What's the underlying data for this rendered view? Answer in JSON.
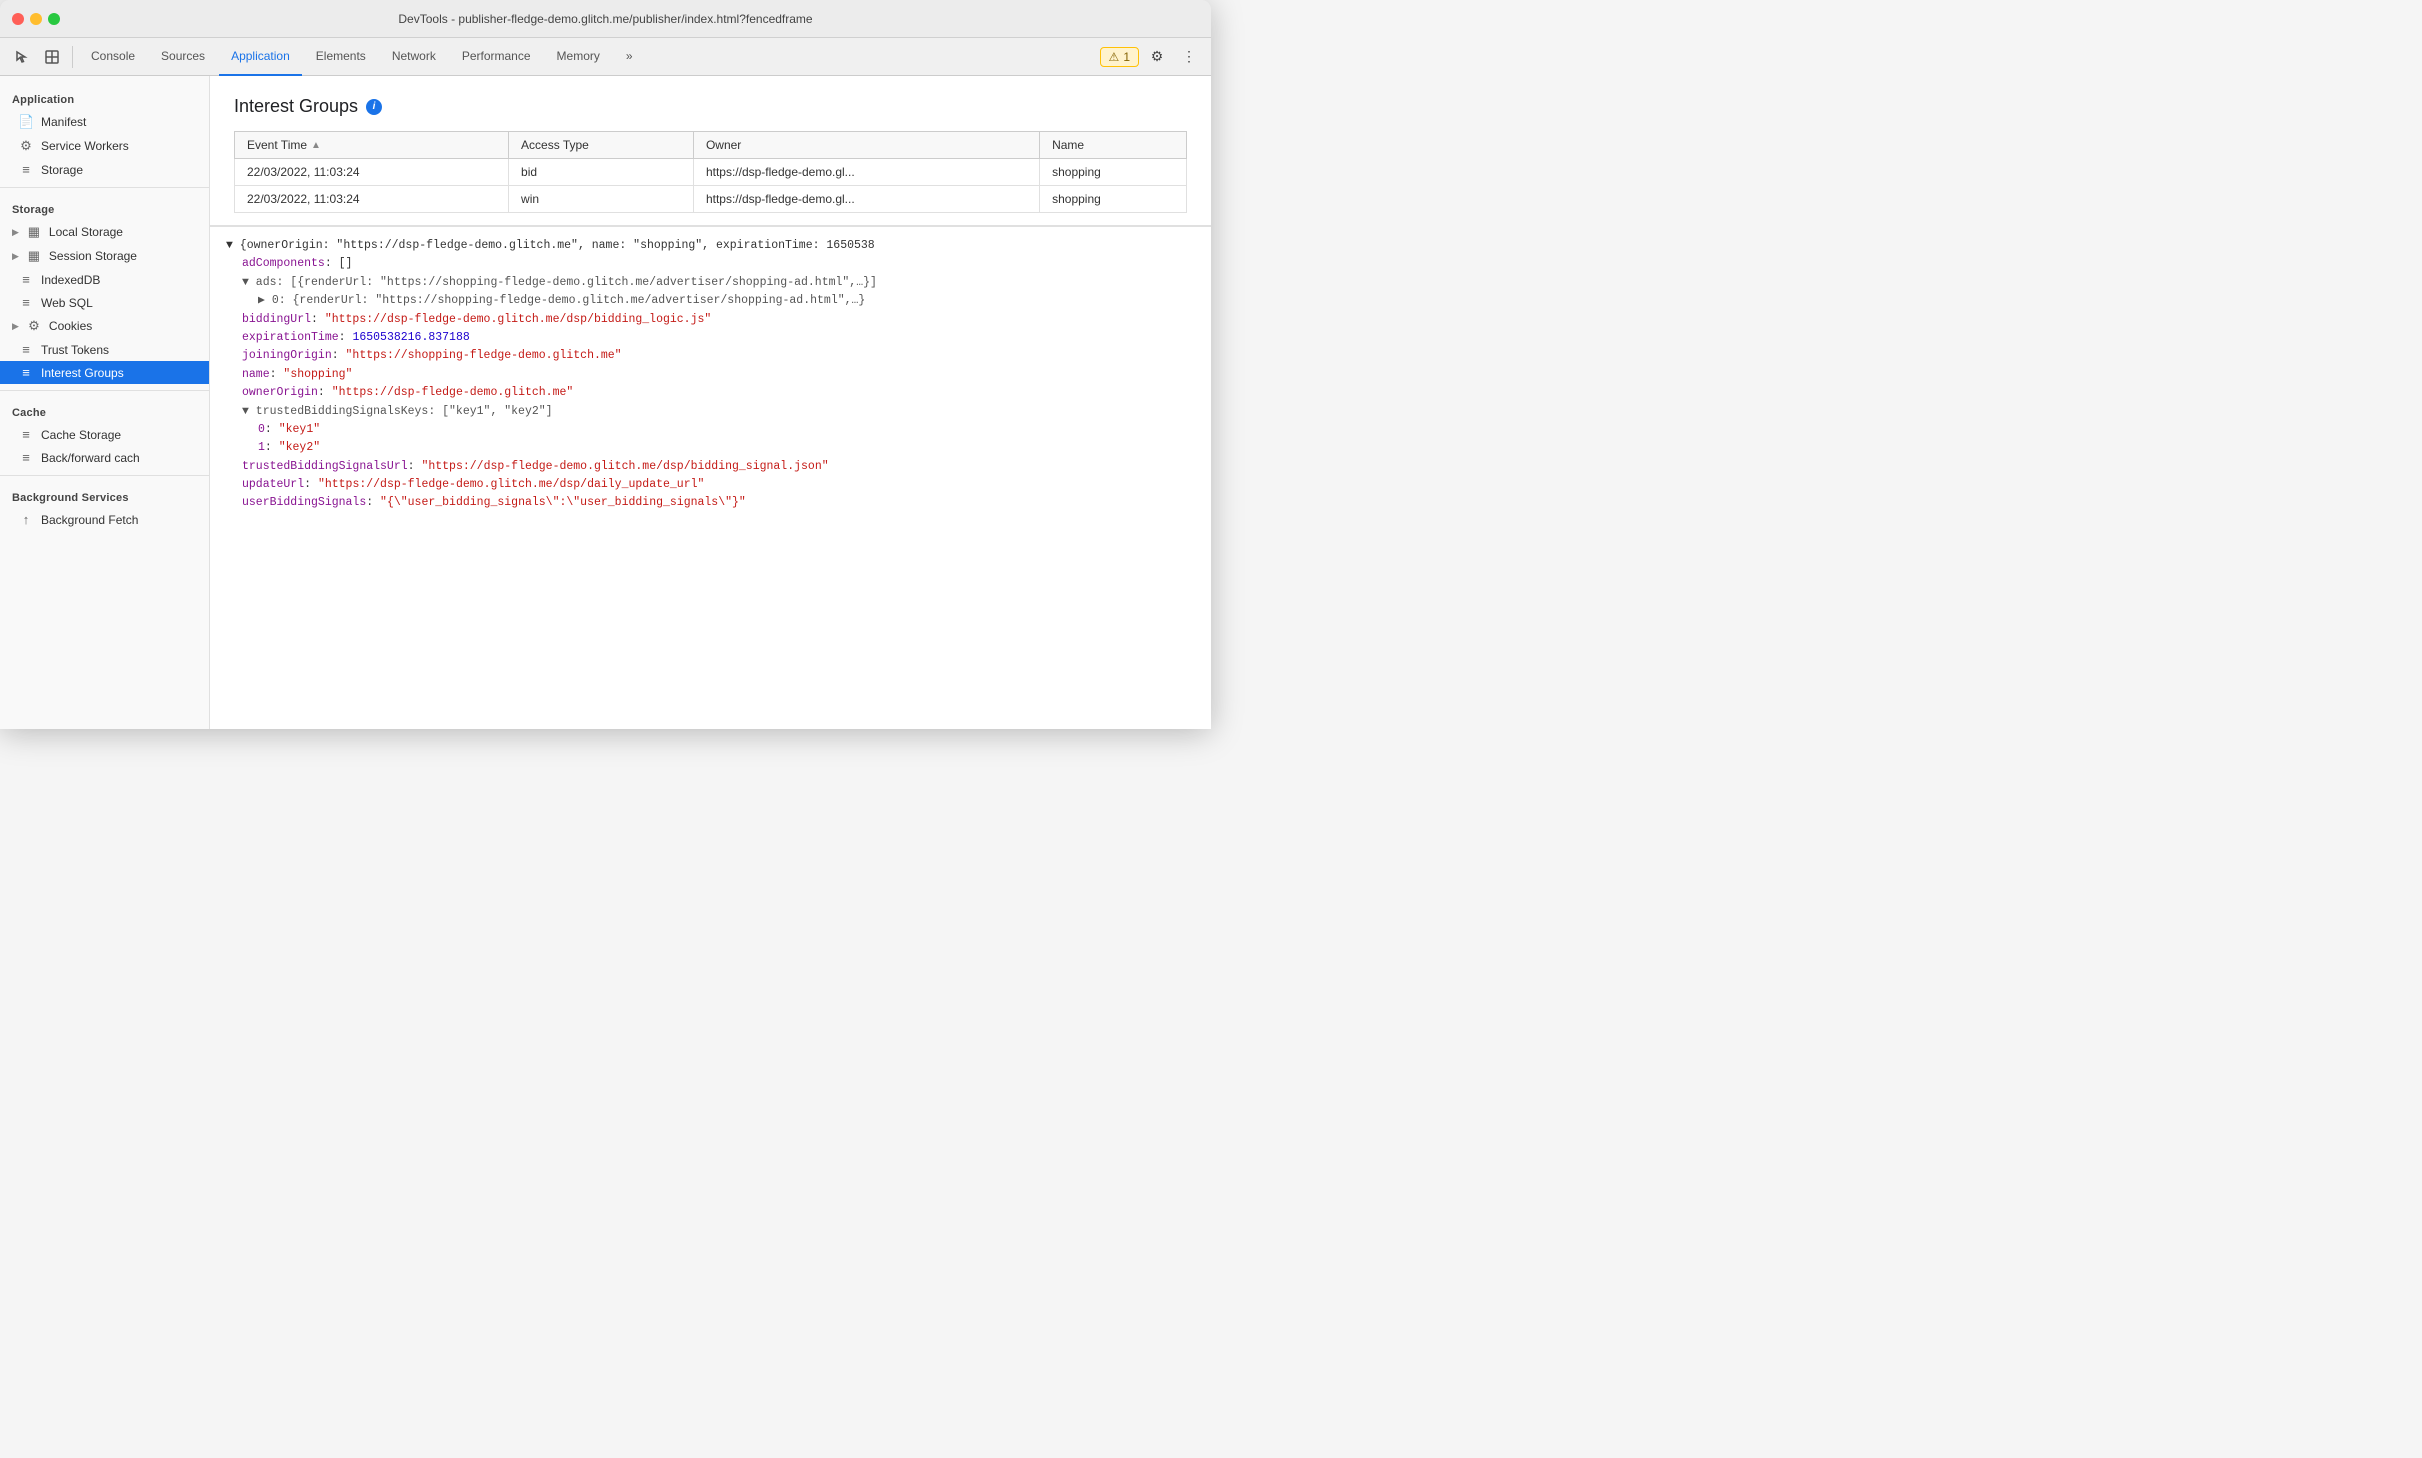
{
  "titleBar": {
    "title": "DevTools - publisher-fledge-demo.glitch.me/publisher/index.html?fencedframe"
  },
  "toolbar": {
    "tabs": [
      {
        "id": "console",
        "label": "Console",
        "active": false
      },
      {
        "id": "sources",
        "label": "Sources",
        "active": false
      },
      {
        "id": "application",
        "label": "Application",
        "active": true
      },
      {
        "id": "elements",
        "label": "Elements",
        "active": false
      },
      {
        "id": "network",
        "label": "Network",
        "active": false
      },
      {
        "id": "performance",
        "label": "Performance",
        "active": false
      },
      {
        "id": "memory",
        "label": "Memory",
        "active": false
      }
    ],
    "overflowLabel": "»",
    "warnCount": "1",
    "settingsLabel": "⚙",
    "moreLabel": "⋮"
  },
  "sidebar": {
    "sections": [
      {
        "title": "Application",
        "items": [
          {
            "id": "manifest",
            "label": "Manifest",
            "icon": "📄",
            "hasArrow": false,
            "active": false
          },
          {
            "id": "service-workers",
            "label": "Service Workers",
            "icon": "⚙",
            "hasArrow": false,
            "active": false
          },
          {
            "id": "storage",
            "label": "Storage",
            "icon": "🗄",
            "hasArrow": false,
            "active": false
          }
        ]
      },
      {
        "title": "Storage",
        "items": [
          {
            "id": "local-storage",
            "label": "Local Storage",
            "icon": "▦",
            "hasArrow": true,
            "active": false
          },
          {
            "id": "session-storage",
            "label": "Session Storage",
            "icon": "▦",
            "hasArrow": true,
            "active": false
          },
          {
            "id": "indexed-db",
            "label": "IndexedDB",
            "icon": "🗄",
            "hasArrow": false,
            "active": false
          },
          {
            "id": "web-sql",
            "label": "Web SQL",
            "icon": "🗄",
            "hasArrow": false,
            "active": false
          },
          {
            "id": "cookies",
            "label": "Cookies",
            "icon": "⚙",
            "hasArrow": true,
            "active": false
          },
          {
            "id": "trust-tokens",
            "label": "Trust Tokens",
            "icon": "🗄",
            "hasArrow": false,
            "active": false
          },
          {
            "id": "interest-groups",
            "label": "Interest Groups",
            "icon": "🗄",
            "hasArrow": false,
            "active": true
          }
        ]
      },
      {
        "title": "Cache",
        "items": [
          {
            "id": "cache-storage",
            "label": "Cache Storage",
            "icon": "🗄",
            "hasArrow": false,
            "active": false
          },
          {
            "id": "back-forward-cache",
            "label": "Back/forward cach",
            "icon": "🗄",
            "hasArrow": false,
            "active": false
          }
        ]
      },
      {
        "title": "Background Services",
        "items": [
          {
            "id": "background-fetch",
            "label": "Background Fetch",
            "icon": "↑",
            "hasArrow": false,
            "active": false
          }
        ]
      }
    ]
  },
  "content": {
    "pageTitle": "Interest Groups",
    "table": {
      "columns": [
        "Event Time",
        "Access Type",
        "Owner",
        "Name"
      ],
      "rows": [
        {
          "eventTime": "22/03/2022, 11:03:24",
          "accessType": "bid",
          "owner": "https://dsp-fledge-demo.gl...",
          "name": "shopping"
        },
        {
          "eventTime": "22/03/2022, 11:03:24",
          "accessType": "win",
          "owner": "https://dsp-fledge-demo.gl...",
          "name": "shopping"
        }
      ]
    },
    "jsonDetail": {
      "lines": [
        {
          "indent": 0,
          "type": "plain",
          "text": "▼ {ownerOrigin: \"https://dsp-fledge-demo.glitch.me\", name: \"shopping\", expirationTime: 1650538"
        },
        {
          "indent": 1,
          "type": "key-plain",
          "key": "adComponents",
          "value": ": []"
        },
        {
          "indent": 1,
          "type": "expand",
          "text": "▼ ads: [{renderUrl: \"https://shopping-fledge-demo.glitch.me/advertiser/shopping-ad.html\",…}]"
        },
        {
          "indent": 2,
          "type": "expand",
          "text": "▶ 0: {renderUrl: \"https://shopping-fledge-demo.glitch.me/advertiser/shopping-ad.html\",…}"
        },
        {
          "indent": 1,
          "type": "key-str",
          "key": "biddingUrl",
          "value": "\"https://dsp-fledge-demo.glitch.me/dsp/bidding_logic.js\""
        },
        {
          "indent": 1,
          "type": "key-num",
          "key": "expirationTime",
          "value": "1650538216.837188"
        },
        {
          "indent": 1,
          "type": "key-str",
          "key": "joiningOrigin",
          "value": "\"https://shopping-fledge-demo.glitch.me\""
        },
        {
          "indent": 1,
          "type": "key-str",
          "key": "name",
          "value": "\"shopping\""
        },
        {
          "indent": 1,
          "type": "key-str",
          "key": "ownerOrigin",
          "value": "\"https://dsp-fledge-demo.glitch.me\""
        },
        {
          "indent": 1,
          "type": "expand",
          "text": "▼ trustedBiddingSignalsKeys: [\"key1\", \"key2\"]"
        },
        {
          "indent": 2,
          "type": "key-str",
          "key": "0",
          "value": "\"key1\""
        },
        {
          "indent": 2,
          "type": "key-str",
          "key": "1",
          "value": "\"key2\""
        },
        {
          "indent": 1,
          "type": "key-str",
          "key": "trustedBiddingSignalsUrl",
          "value": "\"https://dsp-fledge-demo.glitch.me/dsp/bidding_signal.json\""
        },
        {
          "indent": 1,
          "type": "key-str",
          "key": "updateUrl",
          "value": "\"https://dsp-fledge-demo.glitch.me/dsp/daily_update_url\""
        },
        {
          "indent": 1,
          "type": "key-str",
          "key": "userBiddingSignals",
          "value": "\"{\\\"user_bidding_signals\\\":\\\"user_bidding_signals\\\"}\""
        }
      ]
    }
  }
}
